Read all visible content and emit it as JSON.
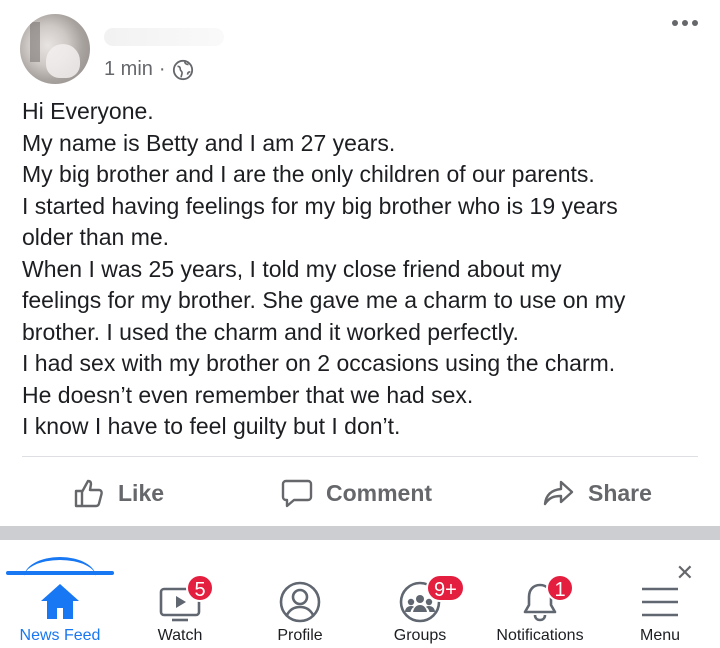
{
  "post": {
    "time": "1 min",
    "separator": "·",
    "lines": [
      "Hi Everyone.",
      "My name is Betty and I am 27 years.",
      "My big brother and I are the only children of our parents.",
      "I started having feelings for my big brother who is 19 years",
      "older than me.",
      "When I was 25 years, I told my close friend about my",
      "feelings for my brother. She gave me a charm to use on my",
      "brother. I used the charm and it worked perfectly.",
      "I had sex with my brother on 2 occasions using the charm.",
      "He doesn’t even remember that we had sex.",
      "I know I have to feel guilty but I don’t."
    ]
  },
  "actions": {
    "like": "Like",
    "comment": "Comment",
    "share": "Share"
  },
  "tabs": {
    "news_feed": {
      "label": "News Feed"
    },
    "watch": {
      "label": "Watch",
      "badge": "5"
    },
    "profile": {
      "label": "Profile"
    },
    "groups": {
      "label": "Groups",
      "badge": "9+"
    },
    "notifications": {
      "label": "Notifications",
      "badge": "1"
    },
    "menu": {
      "label": "Menu"
    }
  },
  "colors": {
    "accent": "#1877f2",
    "badge": "#e41e3f",
    "secondary_text": "#65676b"
  },
  "icons": [
    "globe-icon",
    "more-icon",
    "like-icon",
    "comment-icon",
    "share-icon",
    "home-icon",
    "watch-icon",
    "profile-icon",
    "groups-icon",
    "bell-icon",
    "menu-icon",
    "close-icon"
  ]
}
